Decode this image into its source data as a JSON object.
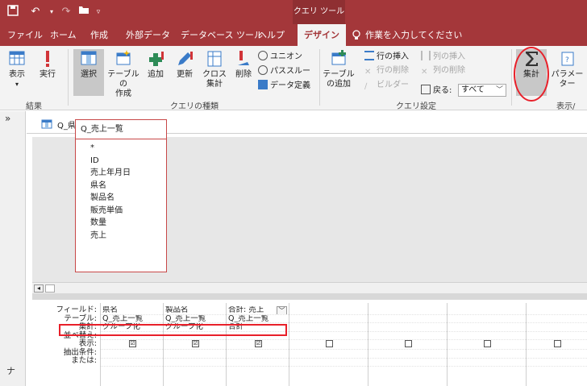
{
  "titlebar": {
    "context_tab": "クエリ ツール"
  },
  "tabs": [
    {
      "label": "ファイル"
    },
    {
      "label": "ホーム"
    },
    {
      "label": "作成"
    },
    {
      "label": "外部データ"
    },
    {
      "label": "データベース ツール"
    },
    {
      "label": "ヘルプ"
    },
    {
      "label": "デザイン"
    }
  ],
  "tellme": "作業を入力してください",
  "ribbon": {
    "results": {
      "view": "表示",
      "run": "実行",
      "group": "結果"
    },
    "query_type": {
      "select": "選択",
      "make_table_1": "テーブルの",
      "make_table_2": "作成",
      "append": "追加",
      "update": "更新",
      "crosstab_1": "クロス",
      "crosstab_2": "集計",
      "delete": "削除",
      "union": "ユニオン",
      "passthrough": "パススルー",
      "data_definition": "データ定義",
      "group": "クエリの種類"
    },
    "query_setup": {
      "show_table_1": "テーブル",
      "show_table_2": "の追加",
      "insert_rows": "行の挿入",
      "delete_rows": "行の削除",
      "builder": "ビルダー",
      "insert_columns": "列の挿入",
      "delete_columns": "列の削除",
      "return_label": "戻る:",
      "return_value": "すべて",
      "group": "クエリ設定"
    },
    "show_hide": {
      "totals": "集計",
      "parameters": "パラメーター",
      "group": "表示/"
    }
  },
  "document": {
    "tab_label": "Q_県別製品別売上"
  },
  "source_table": {
    "title": "Q_売上一覧",
    "fields": [
      "*",
      "ID",
      "売上年月日",
      "県名",
      "製品名",
      "販売単価",
      "数量",
      "売上"
    ]
  },
  "grid": {
    "row_labels": [
      "フィールド:",
      "テーブル:",
      "集計:",
      "並べ替え:",
      "表示:",
      "抽出条件:",
      "または:"
    ],
    "columns": [
      {
        "field": "県名",
        "table": "Q_売上一覧",
        "total": "グループ化",
        "sort": "",
        "show": "☑"
      },
      {
        "field": "製品名",
        "table": "Q_売上一覧",
        "total": "グループ化",
        "sort": "",
        "show": "☑"
      },
      {
        "field": "合計: 売上",
        "table": "Q_売上一覧",
        "total": "合計",
        "sort": "",
        "show": "☑"
      },
      {
        "field": "",
        "table": "",
        "total": "",
        "sort": "",
        "show": ""
      },
      {
        "field": "",
        "table": "",
        "total": "",
        "sort": "",
        "show": ""
      },
      {
        "field": "",
        "table": "",
        "total": "",
        "sort": "",
        "show": ""
      },
      {
        "field": "",
        "table": "",
        "total": "",
        "sort": "",
        "show": ""
      }
    ]
  },
  "nav": {
    "chevron": "»",
    "vertical_label": "ナ"
  },
  "colors": {
    "accent": "#a4373a",
    "highlight": "#e8202a"
  }
}
